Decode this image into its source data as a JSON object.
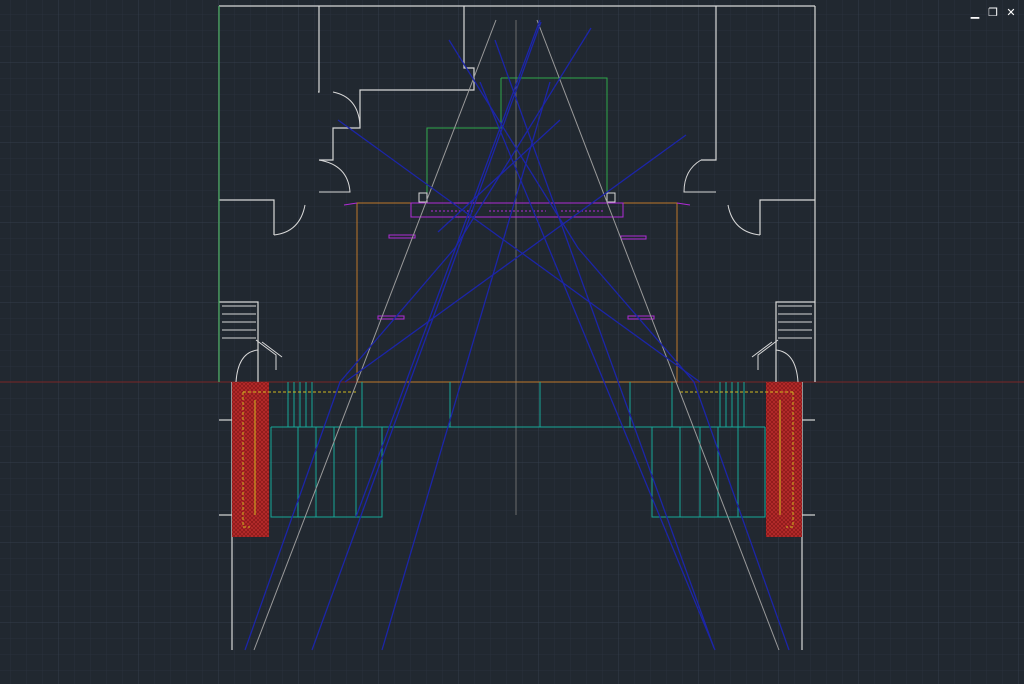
{
  "app": {
    "background_color": "#212830",
    "grid_minor_color": "#2a3340",
    "grid_major_color": "#333e4c"
  },
  "window_controls": {
    "minimize_label": "▁",
    "restore_label": "❐",
    "close_label": "✕"
  },
  "layer_colors": {
    "walls": "#d8d8d8",
    "green": "#2fb34a",
    "blue": "#1c25a8",
    "orange": "#c87e2c",
    "magenta": "#b22bd6",
    "cyan": "#15b2a0",
    "hatch": "#a11f1f",
    "yellow": "#d8c21c",
    "centerline": "#7a7a7a",
    "red_axis": "#8a2a2a",
    "gray_ray": "#a5a5a5"
  },
  "icons": {
    "minimize": "minimize-icon",
    "restore": "restore-icon",
    "close": "close-icon"
  }
}
